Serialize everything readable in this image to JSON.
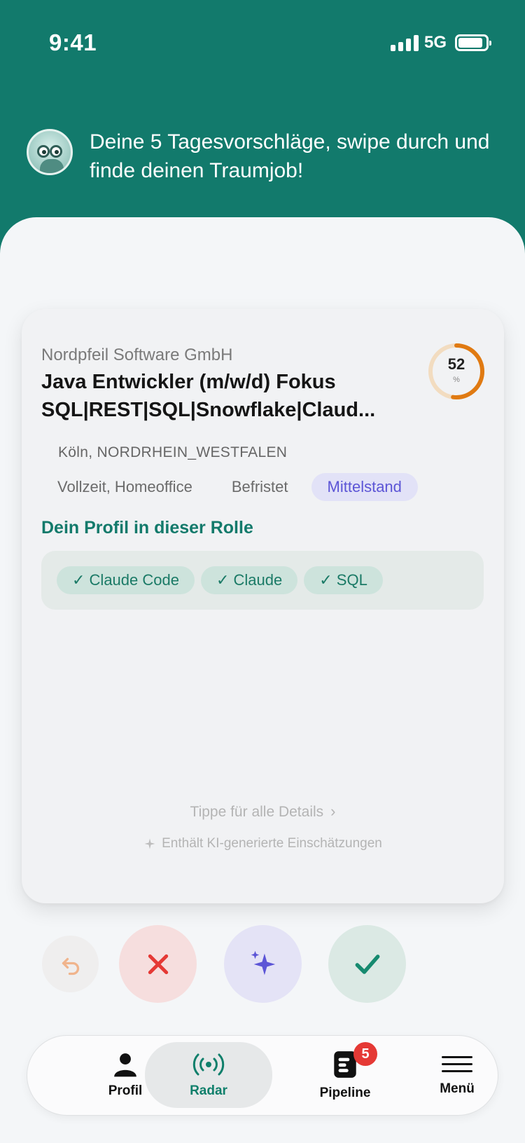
{
  "status_bar": {
    "time": "9:41",
    "network": "5G"
  },
  "header": {
    "greeting": "Deine 5 Tagesvorschläge, swipe durch und finde deinen Traumjob!"
  },
  "job_card": {
    "company": "Nordpfeil Software GmbH",
    "title": "Java Entwickler (m/w/d) Fokus SQL|REST|SQL|Snowflake|Claud...",
    "match_percent": 52,
    "match_value": "52",
    "match_unit": "%",
    "location": "Köln, NORDRHEIN_WESTFALEN",
    "tags": [
      {
        "label": "Vollzeit, Homeoffice",
        "highlight": false
      },
      {
        "label": "Befristet",
        "highlight": false
      },
      {
        "label": "Mittelstand",
        "highlight": true
      }
    ],
    "profile_section_title": "Dein Profil in dieser Rolle",
    "skills": [
      "✓ Claude Code",
      "✓ Claude",
      "✓ SQL"
    ],
    "details_link": "Tippe für alle Details",
    "ai_note": "Enthält KI-generierte Einschätzungen"
  },
  "actions": {
    "undo": "undo-icon",
    "nope": "x-icon",
    "super": "sparkle-icon",
    "like": "check-icon"
  },
  "tabbar": {
    "items": [
      {
        "label": "Profil",
        "icon": "person-icon"
      },
      {
        "label": "Radar",
        "icon": "radar-icon"
      },
      {
        "label": "Pipeline",
        "icon": "pipeline-icon"
      },
      {
        "label": "Menü",
        "icon": "menu-icon"
      }
    ],
    "active": "Radar",
    "pipeline_badge": "5"
  },
  "colors": {
    "brand": "#127a6c",
    "accent_orange": "#e07a12",
    "nope_red": "#e53935",
    "super_purple": "#5c55d6",
    "like_green": "#168a6f"
  }
}
